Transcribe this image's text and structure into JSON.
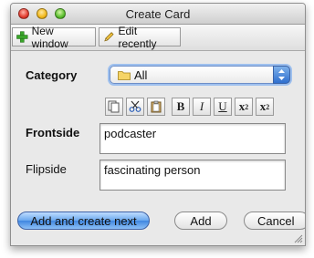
{
  "window": {
    "title": "Create Card"
  },
  "toolbar": {
    "new_window": "New window",
    "edit_recently": "Edit recently"
  },
  "form": {
    "category_label": "Category",
    "category_value": "All",
    "frontside_label": "Frontside",
    "frontside_value": "podcaster",
    "flipside_label": "Flipside",
    "flipside_value": "fascinating person"
  },
  "format_buttons": {
    "bold": "B",
    "italic": "I",
    "underline": "U",
    "superscript": "x",
    "subscript": "x",
    "sup_mark": "2",
    "sub_mark": "2"
  },
  "buttons": {
    "add_create_next": "Add and create next",
    "add": "Add",
    "cancel": "Cancel"
  },
  "colors": {
    "accent": "#3f86e0",
    "focus_ring": "#9ec0ee"
  }
}
